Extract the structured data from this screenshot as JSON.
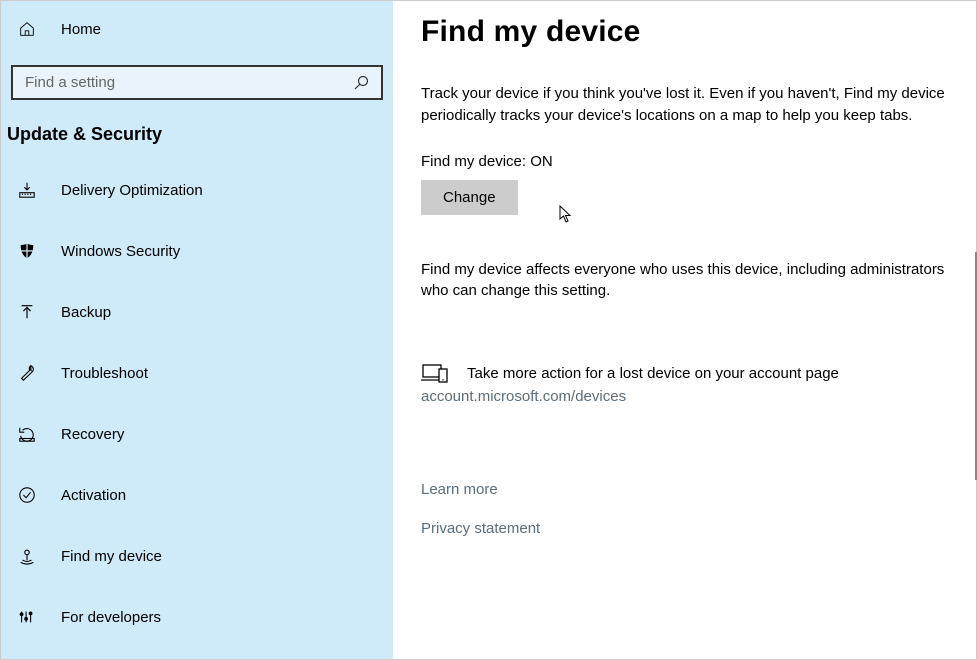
{
  "sidebar": {
    "home_label": "Home",
    "search_placeholder": "Find a setting",
    "heading": "Update & Security",
    "items": [
      {
        "label": "Delivery Optimization"
      },
      {
        "label": "Windows Security"
      },
      {
        "label": "Backup"
      },
      {
        "label": "Troubleshoot"
      },
      {
        "label": "Recovery"
      },
      {
        "label": "Activation"
      },
      {
        "label": "Find my device"
      },
      {
        "label": "For developers"
      }
    ]
  },
  "main": {
    "title": "Find my device",
    "description": "Track your device if you think you've lost it. Even if you haven't, Find my device periodically tracks your device's locations on a map to help you keep tabs.",
    "status_label": "Find my device: ON",
    "change_button": "Change",
    "affect_text": "Find my device affects everyone who uses this device, including administrators who can change this setting.",
    "action_text": "Take more action for a lost device on your account page",
    "account_link": "account.microsoft.com/devices",
    "learn_more": "Learn more",
    "privacy": "Privacy statement"
  }
}
